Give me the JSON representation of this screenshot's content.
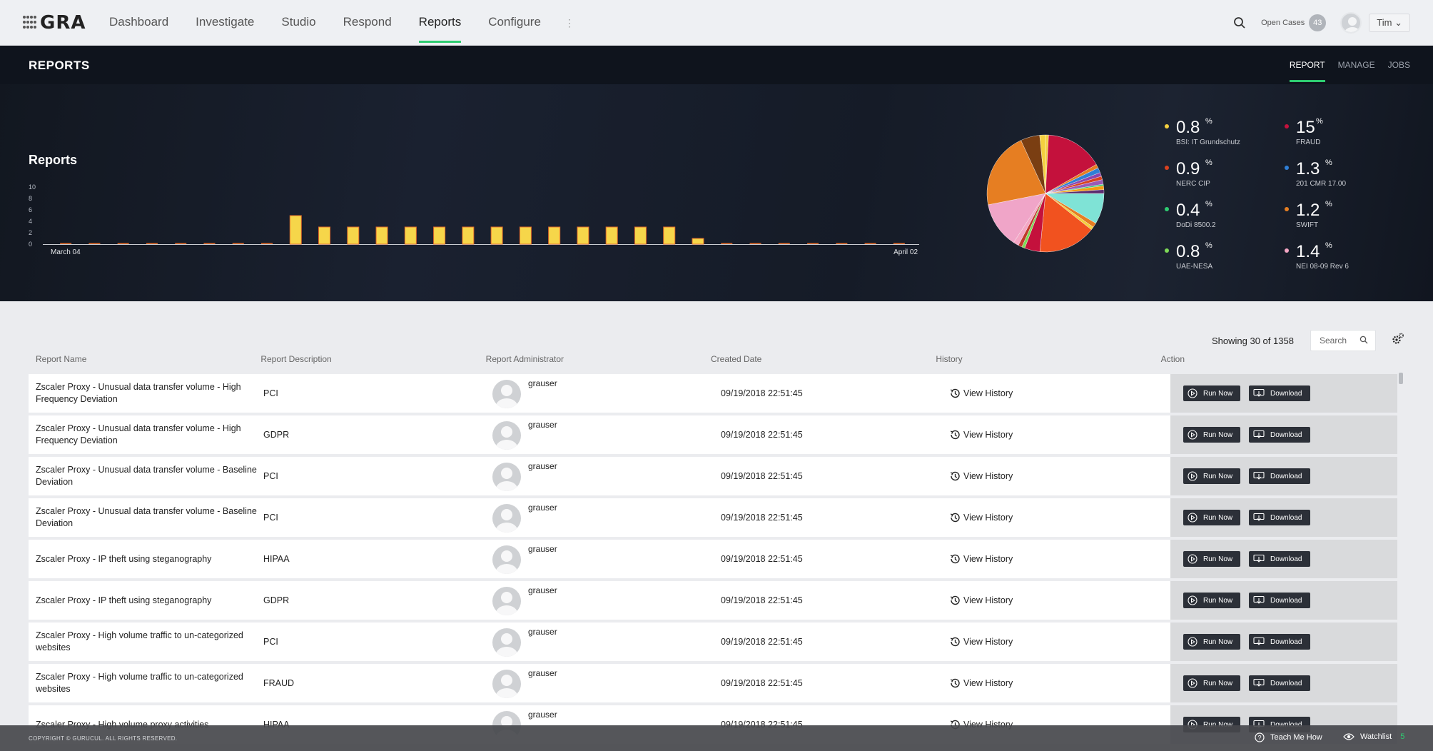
{
  "app": {
    "logo": "GRA",
    "nav": [
      "Dashboard",
      "Investigate",
      "Studio",
      "Respond",
      "Reports",
      "Configure"
    ],
    "active_nav": "Reports",
    "more": "⋮",
    "open_cases_label": "Open Cases",
    "open_cases_count": "43",
    "user_name": "Tim"
  },
  "header": {
    "title": "REPORTS",
    "tabs": [
      "REPORT",
      "MANAGE",
      "JOBS"
    ],
    "active_tab": "REPORT"
  },
  "chart_data": [
    {
      "type": "bar",
      "title": "Reports",
      "ylim": [
        0,
        10
      ],
      "yticks": [
        "10",
        "8",
        "6",
        "4",
        "2",
        "0"
      ],
      "x_start_label": "March 04",
      "x_end_label": "April 02",
      "values": [
        0,
        0,
        0,
        0,
        0,
        0,
        0,
        0,
        5,
        3,
        3,
        3,
        3,
        3,
        3,
        3,
        3,
        3,
        3,
        3,
        3,
        3,
        1,
        0,
        0,
        0,
        0,
        0,
        0,
        0
      ],
      "bar_color": "#f6d64a",
      "baseline_color": "#e06a2a"
    },
    {
      "type": "pie",
      "slices": [
        {
          "label": "BSI: IT Grundschutz",
          "value": 0.8,
          "color": "#f4d03f"
        },
        {
          "label": "FRAUD",
          "value": 15,
          "color": "#c4113c"
        },
        {
          "label": "",
          "value": 1,
          "color": "#e67e22"
        },
        {
          "label": "201 CMR 17.00",
          "value": 1.3,
          "color": "#2f7fd6"
        },
        {
          "label": "",
          "value": 1,
          "color": "#8e44ad"
        },
        {
          "label": "NERC CIP",
          "value": 0.9,
          "color": "#d9411f"
        },
        {
          "label": "",
          "value": 1.2,
          "color": "#9b59b6"
        },
        {
          "label": "DoDi 8500.2",
          "value": 0.4,
          "color": "#2ecc71"
        },
        {
          "label": "",
          "value": 1,
          "color": "#f39c12"
        },
        {
          "label": "",
          "value": 1,
          "color": "#5b2c6f"
        },
        {
          "label": "",
          "value": 8,
          "color": "#7fe3d6"
        },
        {
          "label": "SWIFT",
          "value": 1.2,
          "color": "#e67e22"
        },
        {
          "label": "",
          "value": 0.8,
          "color": "#f4d03f"
        },
        {
          "label": "",
          "value": 15,
          "color": "#f1521f"
        },
        {
          "label": "",
          "value": 4,
          "color": "#c4113c"
        },
        {
          "label": "UAE-NESA",
          "value": 0.8,
          "color": "#7ed957"
        },
        {
          "label": "",
          "value": 1,
          "color": "#c0392b"
        },
        {
          "label": "NEI 08-09 Rev 6",
          "value": 1.4,
          "color": "#f4a6c4"
        },
        {
          "label": "",
          "value": 12,
          "color": "#f0a5c8"
        },
        {
          "label": "",
          "value": 20,
          "color": "#e67e22"
        },
        {
          "label": "",
          "value": 5,
          "color": "#7a3e12"
        },
        {
          "label": "",
          "value": 1.5,
          "color": "#f4d03f"
        }
      ]
    }
  ],
  "legend": [
    {
      "value": "0.8",
      "label": "BSI: IT Grundschutz",
      "color": "#f4d03f"
    },
    {
      "value": "15",
      "label": "FRAUD",
      "color": "#c4113c"
    },
    {
      "value": "0.9",
      "label": "NERC CIP",
      "color": "#d9411f"
    },
    {
      "value": "1.3",
      "label": "201 CMR 17.00",
      "color": "#2f7fd6"
    },
    {
      "value": "0.4",
      "label": "DoDi 8500.2",
      "color": "#2ecc71"
    },
    {
      "value": "1.2",
      "label": "SWIFT",
      "color": "#e67e22"
    },
    {
      "value": "0.8",
      "label": "UAE-NESA",
      "color": "#7ed957"
    },
    {
      "value": "1.4",
      "label": "NEI 08-09 Rev 6",
      "color": "#f4a6c4"
    }
  ],
  "legend_pct": "%",
  "table": {
    "showing": "Showing 30 of 1358",
    "search_placeholder": "Search",
    "headers": [
      "Report Name",
      "Report Description",
      "Report Administrator",
      "Created Date",
      "History",
      "Action"
    ],
    "run_label": "Run Now",
    "download_label": "Download",
    "history_label": "View History",
    "rows": [
      {
        "name": "Zscaler Proxy - Unusual data transfer volume - High Frequency Deviation",
        "desc": "PCI",
        "admin": "grauser",
        "date": "09/19/2018 22:51:45"
      },
      {
        "name": "Zscaler Proxy - Unusual data transfer volume - High Frequency Deviation",
        "desc": "GDPR",
        "admin": "grauser",
        "date": "09/19/2018 22:51:45"
      },
      {
        "name": "Zscaler Proxy - Unusual data transfer volume - Baseline Deviation",
        "desc": "PCI",
        "admin": "grauser",
        "date": "09/19/2018 22:51:45"
      },
      {
        "name": "Zscaler Proxy - Unusual data transfer volume - Baseline Deviation",
        "desc": "PCI",
        "admin": "grauser",
        "date": "09/19/2018 22:51:45"
      },
      {
        "name": "Zscaler Proxy - IP theft using steganography",
        "desc": "HIPAA",
        "admin": "grauser",
        "date": "09/19/2018 22:51:45"
      },
      {
        "name": "Zscaler Proxy - IP theft using steganography",
        "desc": "GDPR",
        "admin": "grauser",
        "date": "09/19/2018 22:51:45"
      },
      {
        "name": "Zscaler Proxy - High volume traffic to un-categorized websites",
        "desc": "PCI",
        "admin": "grauser",
        "date": "09/19/2018 22:51:45"
      },
      {
        "name": "Zscaler Proxy - High volume traffic to un-categorized websites",
        "desc": "FRAUD",
        "admin": "grauser",
        "date": "09/19/2018 22:51:45"
      },
      {
        "name": "Zscaler Proxy - High volume proxy activities",
        "desc": "HIPAA",
        "admin": "grauser",
        "date": "09/19/2018 22:51:45"
      }
    ]
  },
  "footer": {
    "copyright": "COPYRIGHT © GURUCUL. ALL RIGHTS RESERVED.",
    "teach": "Teach Me How",
    "watchlist": "Watchlist",
    "watch_count": "5"
  },
  "colors": {
    "accent": "#2ecc71",
    "hero_bg": "#151b27",
    "button_bg": "#2c3038"
  }
}
